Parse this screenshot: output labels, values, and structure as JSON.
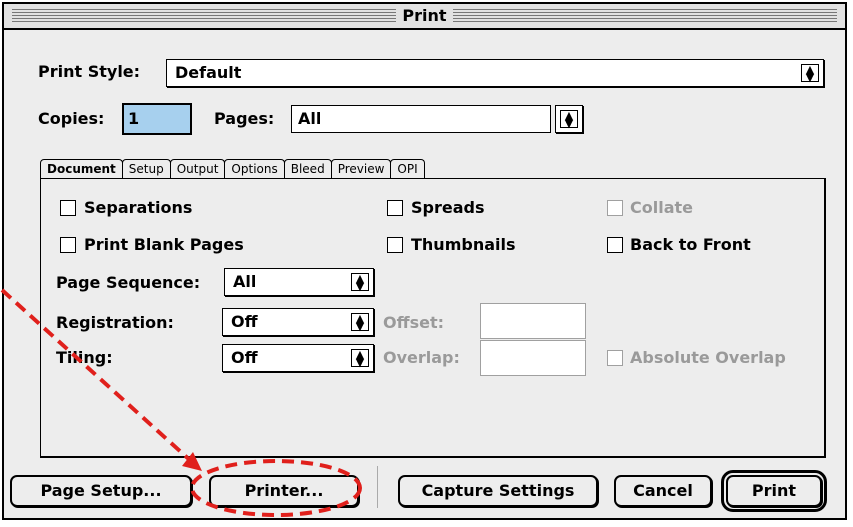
{
  "window": {
    "title": "Print"
  },
  "print_style": {
    "label": "Print Style:",
    "value": "Default"
  },
  "copies": {
    "label": "Copies:",
    "value": "1"
  },
  "pages": {
    "label": "Pages:",
    "value": "All"
  },
  "tabs": [
    "Document",
    "Setup",
    "Output",
    "Options",
    "Bleed",
    "Preview",
    "OPI"
  ],
  "document": {
    "separations": "Separations",
    "spreads": "Spreads",
    "collate": "Collate",
    "print_blank_pages": "Print Blank Pages",
    "thumbnails": "Thumbnails",
    "back_to_front": "Back to Front",
    "page_sequence": {
      "label": "Page Sequence:",
      "value": "All"
    },
    "registration": {
      "label": "Registration:",
      "value": "Off"
    },
    "offset": {
      "label": "Offset:",
      "value": ""
    },
    "tiling": {
      "label": "Tiling:",
      "value": "Off"
    },
    "overlap": {
      "label": "Overlap:",
      "value": ""
    },
    "absolute_overlap": "Absolute Overlap"
  },
  "buttons": {
    "page_setup": "Page Setup...",
    "printer": "Printer...",
    "capture_settings": "Capture Settings",
    "cancel": "Cancel",
    "print": "Print"
  },
  "colors": {
    "highlight": "#a7d0ee",
    "annotation": "#e0201c"
  }
}
